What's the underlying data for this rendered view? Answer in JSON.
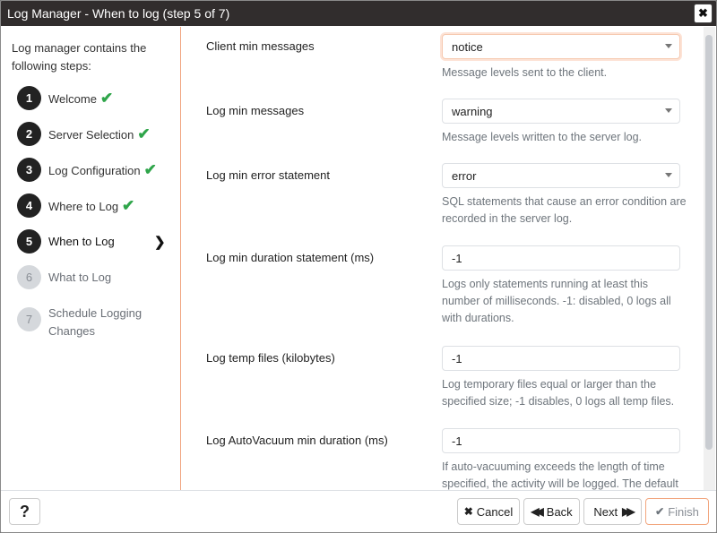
{
  "window": {
    "title": "Log Manager - When to log (step 5 of 7)",
    "close_label": "✖"
  },
  "sidebar": {
    "intro": "Log manager contains the following steps:",
    "steps": [
      {
        "num": "1",
        "label": "Welcome",
        "status": "done"
      },
      {
        "num": "2",
        "label": "Server Selection",
        "status": "done"
      },
      {
        "num": "3",
        "label": "Log Configuration",
        "status": "done"
      },
      {
        "num": "4",
        "label": "Where to Log",
        "status": "done"
      },
      {
        "num": "5",
        "label": "When to Log",
        "status": "active"
      },
      {
        "num": "6",
        "label": "What to Log",
        "status": "pending"
      },
      {
        "num": "7",
        "label": "Schedule Logging Changes",
        "status": "pending"
      }
    ],
    "check_glyph": "✔",
    "active_glyph": "❯"
  },
  "form": {
    "fields": [
      {
        "label": "Client min messages",
        "type": "select",
        "value": "notice",
        "help": "Message levels sent to the client."
      },
      {
        "label": "Log min messages",
        "type": "select",
        "value": "warning",
        "help": "Message levels written to the server log."
      },
      {
        "label": "Log min error statement",
        "type": "select",
        "value": "error",
        "help": "SQL statements that cause an error condition are recorded in the server log."
      },
      {
        "label": "Log min duration statement (ms)",
        "type": "text",
        "value": "-1",
        "help": "Logs only statements running at least this number of milliseconds. -1: disabled, 0 logs all with durations."
      },
      {
        "label": "Log temp files (kilobytes)",
        "type": "text",
        "value": "-1",
        "help": "Log temporary files equal or larger than the specified size; -1 disables, 0 logs all temp files."
      },
      {
        "label": "Log AutoVacuum min duration (ms)",
        "type": "text",
        "value": "-1",
        "help": "If auto-vacuuming exceeds the length of time specified, the activity will be logged. The default"
      }
    ]
  },
  "footer": {
    "help_label": "?",
    "cancel_icon": "✖",
    "cancel_label": "Cancel",
    "back_icon": "◀◀",
    "back_label": "Back",
    "next_label": "Next",
    "next_icon": "▶▶",
    "finish_icon": "✔",
    "finish_label": "Finish"
  },
  "colors": {
    "titlebar": "#312d2d",
    "accent": "#f0a480",
    "check": "#2fa54a"
  }
}
